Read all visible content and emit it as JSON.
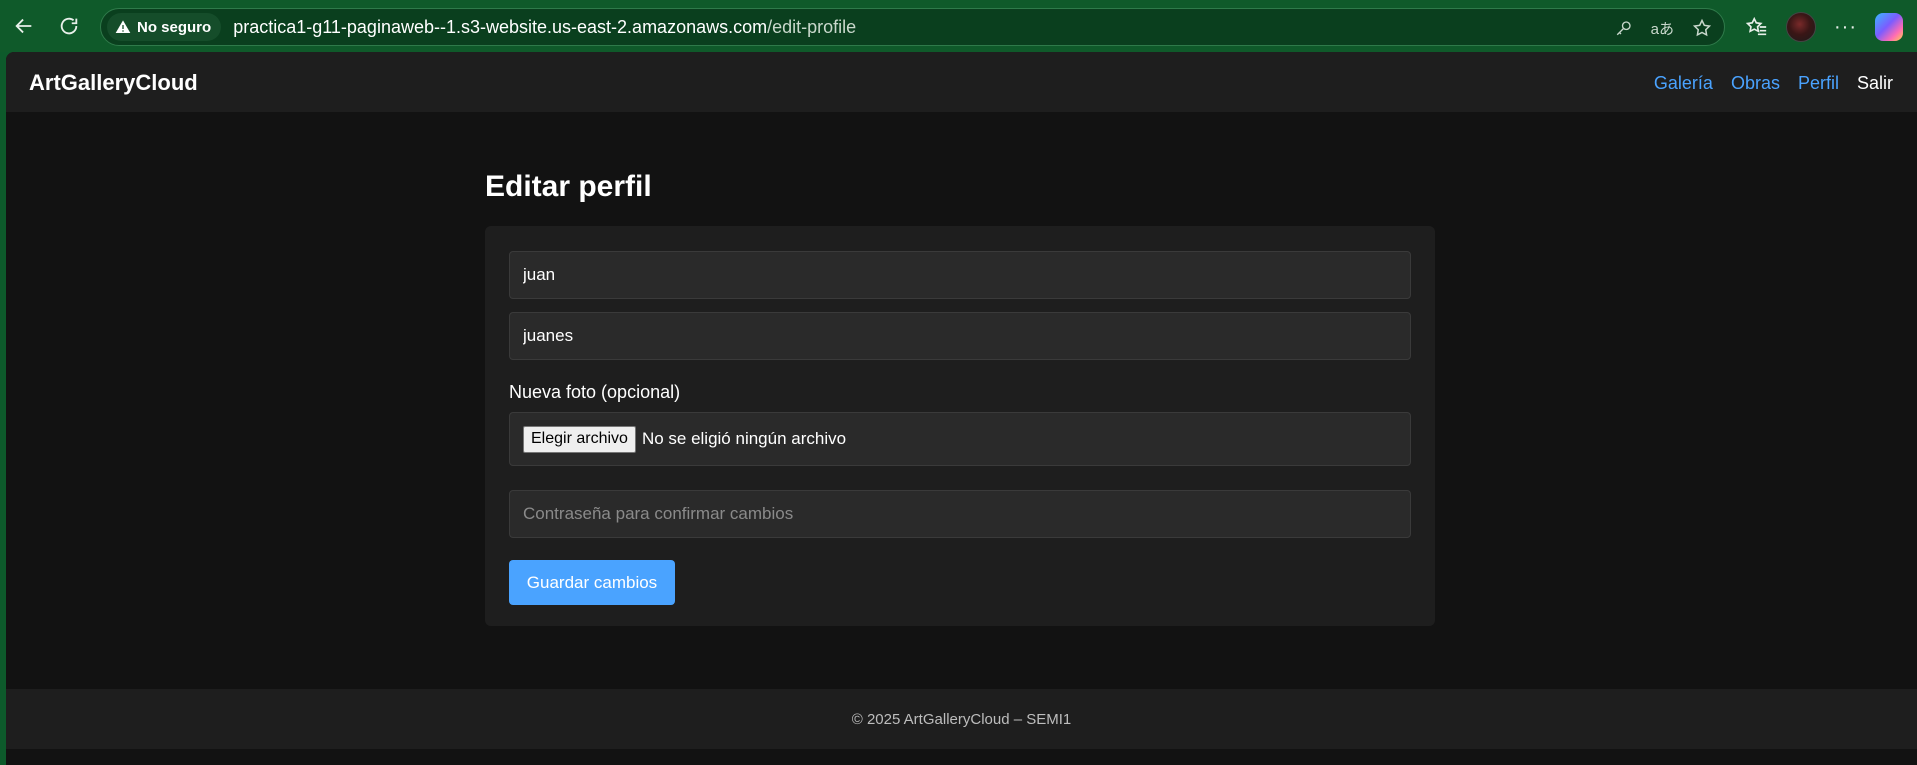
{
  "browser": {
    "security_label": "No seguro",
    "url_host": "practica1-g11-paginaweb--1.s3-website.us-east-2.amazonaws.com",
    "url_path": "/edit-profile"
  },
  "header": {
    "brand": "ArtGalleryCloud",
    "nav": {
      "gallery": "Galería",
      "works": "Obras",
      "profile": "Perfil",
      "logout": "Salir"
    }
  },
  "main": {
    "title": "Editar perfil",
    "form": {
      "name_value": "juan",
      "username_value": "juanes",
      "photo_label": "Nueva foto (opcional)",
      "file_button": "Elegir archivo",
      "file_status": "No se eligió ningún archivo",
      "password_placeholder": "Contraseña para confirmar cambios",
      "submit_label": "Guardar cambios"
    }
  },
  "footer": {
    "text": "© 2025 ArtGalleryCloud – SEMI1"
  },
  "colors": {
    "accent": "#4aa3ff",
    "background": "#121212",
    "surface": "#1e1e1e"
  }
}
